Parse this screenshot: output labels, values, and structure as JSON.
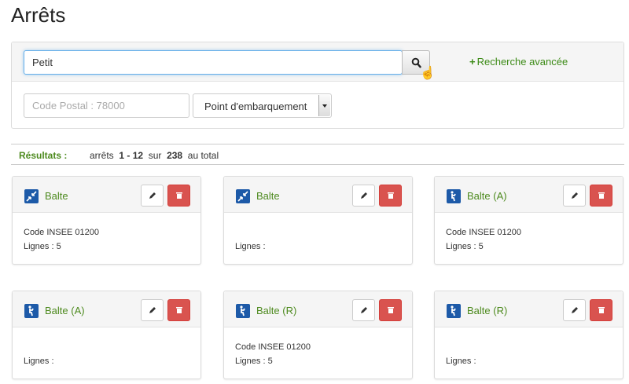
{
  "page": {
    "title": "Arrêts"
  },
  "search": {
    "value": "Petit",
    "advanced_label": "Recherche avancée",
    "postal_placeholder": "Code Postal : 78000",
    "type_select_value": "Point d'embarquement"
  },
  "results": {
    "label": "Résultats :",
    "prefix": "arrêts",
    "range": "1 - 12",
    "sur": "sur",
    "total": "238",
    "suffix": "au total"
  },
  "colors": {
    "accent_green": "#4d8a1e",
    "icon_blue": "#1d5aa8",
    "danger": "#d9534f",
    "focus": "#66afe9"
  },
  "cards": [
    {
      "title": "Balte",
      "icon": "area-arrows-icon",
      "line1": "Code INSEE 01200",
      "line2": "Lignes : 5"
    },
    {
      "title": "Balte",
      "icon": "area-arrows-icon",
      "line1": "",
      "line2": "Lignes :"
    },
    {
      "title": "Balte (A)",
      "icon": "boarding-person-icon",
      "line1": "Code INSEE 01200",
      "line2": "Lignes : 5"
    },
    {
      "title": "Balte (A)",
      "icon": "boarding-person-icon",
      "line1": "",
      "line2": "Lignes :"
    },
    {
      "title": "Balte (R)",
      "icon": "boarding-person-icon",
      "line1": "Code INSEE 01200",
      "line2": "Lignes : 5"
    },
    {
      "title": "Balte (R)",
      "icon": "boarding-person-icon",
      "line1": "",
      "line2": "Lignes :"
    }
  ]
}
